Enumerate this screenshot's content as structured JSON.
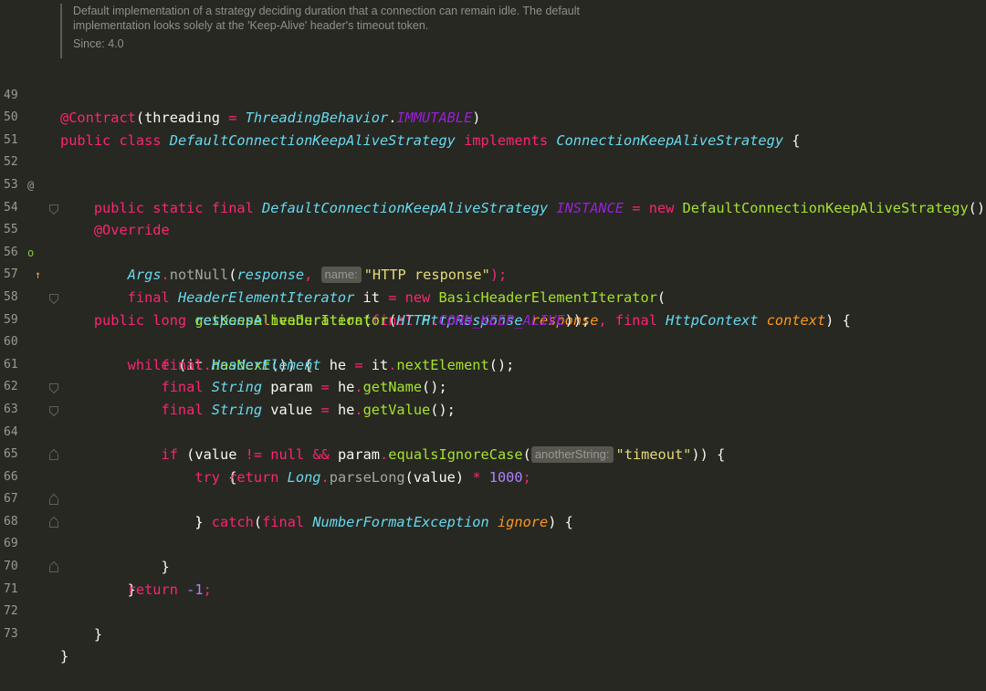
{
  "doc_comment": {
    "line1": "Default implementation of a strategy deciding duration that a connection can remain idle. The default",
    "line2": "implementation looks solely at the 'Keep-Alive' header's timeout token.",
    "since": "Since: 4.0"
  },
  "gutter": {
    "line_numbers": [
      "49",
      "50",
      "51",
      "52",
      "53",
      "54",
      "55",
      "56",
      "57",
      "58",
      "59",
      "60",
      "61",
      "62",
      "63",
      "64",
      "65",
      "66",
      "67",
      "68",
      "69",
      "70",
      "71",
      "72",
      "73"
    ],
    "marker_52": "@",
    "marker_55_a": "o",
    "marker_55_b": "↑"
  },
  "code": {
    "l49": [
      "@Contract",
      "(threading ",
      "= ",
      "ThreadingBehavior",
      ".",
      "IMMUTABLE",
      ")"
    ],
    "l50": [
      "public class ",
      "DefaultConnectionKeepAliveStrategy",
      " implements ",
      "ConnectionKeepAliveStrategy",
      " {"
    ],
    "l52": [
      "    public static final ",
      "DefaultConnectionKeepAliveStrategy",
      " ",
      "INSTANCE",
      " = ",
      "new ",
      "DefaultConnectionKeepAliveStrategy",
      "();"
    ],
    "l54": [
      "    @Override"
    ],
    "l55": [
      "    public long ",
      "getKeepAliveDuration",
      "(",
      "final ",
      "HttpResponse",
      " ",
      "response",
      ", ",
      "final ",
      "HttpContext",
      " ",
      "context",
      ") {"
    ],
    "l56": [
      "        ",
      "Args",
      ".",
      "notNull",
      "(",
      "response",
      ", ",
      "name:",
      "\"HTTP response\"",
      ");"
    ],
    "l57": [
      "        final ",
      "HeaderElementIterator",
      " it ",
      "= ",
      "new ",
      "BasicHeaderElementIterator",
      "("
    ],
    "l58": [
      "                ",
      "response",
      ".",
      "headerIterator",
      "(",
      "HTTP",
      ".",
      "CONN_KEEP_ALIVE",
      "));"
    ],
    "l59": [
      "        while ",
      "(it",
      ".",
      "hasNext",
      "()) {"
    ],
    "l60": [
      "            final ",
      "HeaderElement",
      " he ",
      "= ",
      "it",
      ".",
      "nextElement",
      "();"
    ],
    "l61": [
      "            final ",
      "String",
      " param ",
      "= ",
      "he",
      ".",
      "getName",
      "();"
    ],
    "l62": [
      "            final ",
      "String",
      " value ",
      "= ",
      "he",
      ".",
      "getValue",
      "();"
    ],
    "l63": [
      "            if ",
      "(value ",
      "!= ",
      "null ",
      "&& ",
      "param",
      ".",
      "equalsIgnoreCase",
      "(",
      "anotherString:",
      "\"timeout\"",
      ")) {"
    ],
    "l64": [
      "                try ",
      "{"
    ],
    "l65": [
      "                    return ",
      "Long",
      ".",
      "parseLong",
      "(value) ",
      "* ",
      "1000",
      ";"
    ],
    "l66": [
      "                } ",
      "catch",
      "(",
      "final ",
      "NumberFormatException",
      " ",
      "ignore",
      ") {"
    ],
    "l67": [
      "                }"
    ],
    "l68": [
      "            }"
    ],
    "l69": [
      "        }"
    ],
    "l70": [
      "        return ",
      "-1",
      ";"
    ],
    "l71": [
      "    }"
    ],
    "l73": [
      "}"
    ]
  }
}
